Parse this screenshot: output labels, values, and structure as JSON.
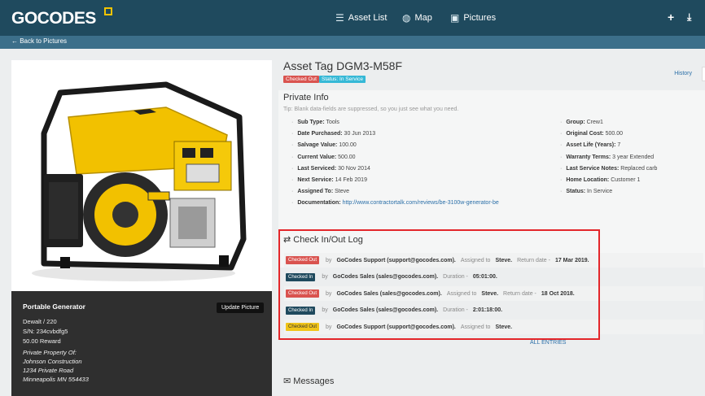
{
  "header": {
    "logo": "GOCODES",
    "nav": [
      {
        "label": "Asset List",
        "icon": "list-icon"
      },
      {
        "label": "Map",
        "icon": "globe-icon"
      },
      {
        "label": "Pictures",
        "icon": "pictures-icon"
      }
    ],
    "right_icons": [
      "plus-icon",
      "download-icon"
    ]
  },
  "subbar": {
    "back_label": "← Back to Pictures"
  },
  "left_panel": {
    "name": "Portable Generator",
    "update_button": "Update Picture",
    "model": "Dewalt / 220",
    "serial": "S/N: 234cvbdfg5",
    "reward": "50.00 Reward",
    "property_lines": [
      "Private Property Of:",
      "Johnson Construction",
      "1234 Private Road",
      "Minneapolis MN 554433"
    ]
  },
  "asset": {
    "title": "Asset Tag DGM3-M58F",
    "badges": [
      {
        "label": "Checked Out",
        "color": "#d9534f"
      },
      {
        "label": "Status: In Service",
        "color": "#35b8d6"
      }
    ],
    "history_label": "History"
  },
  "private_info": {
    "heading": "Private Info",
    "tip": "Tip: Blank data-fields are suppressed, so you just see what you need.",
    "left_fields": [
      {
        "label": "Sub Type:",
        "value": "Tools"
      },
      {
        "label": "Date Purchased:",
        "value": "30 Jun 2013"
      },
      {
        "label": "Salvage Value:",
        "value": "100.00"
      },
      {
        "label": "Current Value:",
        "value": "500.00"
      },
      {
        "label": "Last Serviced:",
        "value": "30 Nov 2014"
      },
      {
        "label": "Next Service:",
        "value": "14 Feb 2019"
      },
      {
        "label": "Assigned To:",
        "value": "Steve"
      },
      {
        "label": "Documentation:",
        "value": "http://www.contractortalk.com/reviews/be-3100w-generator-be"
      }
    ],
    "right_fields": [
      {
        "label": "Group:",
        "value": "Crew1"
      },
      {
        "label": "Original Cost:",
        "value": "500.00"
      },
      {
        "label": "Asset Life (Years):",
        "value": "7"
      },
      {
        "label": "Warranty Terms:",
        "value": "3 year Extended"
      },
      {
        "label": "Last Service Notes:",
        "value": "Replaced carb"
      },
      {
        "label": "Home Location:",
        "value": "Customer 1"
      },
      {
        "label": "Status:",
        "value": "In Service"
      }
    ]
  },
  "log": {
    "heading": "Check In/Out Log",
    "entries": [
      {
        "tag": "Checked Out",
        "tag_color": "#d9534f",
        "by": "by",
        "who": "GoCodes Support (support@gocodes.com).",
        "assigned_label": "Assigned to",
        "assignee": "Steve.",
        "extra_label": "Return date -",
        "extra_value": "17 Mar 2019."
      },
      {
        "tag": "Checked In",
        "tag_color": "#1f4a5e",
        "by": "by",
        "who": "GoCodes Sales (sales@gocodes.com).",
        "assigned_label": "",
        "assignee": "",
        "extra_label": "Duration -",
        "extra_value": "05:01:00."
      },
      {
        "tag": "Checked Out",
        "tag_color": "#d9534f",
        "by": "by",
        "who": "GoCodes Sales (sales@gocodes.com).",
        "assigned_label": "Assigned to",
        "assignee": "Steve.",
        "extra_label": "Return date -",
        "extra_value": "18 Oct 2018."
      },
      {
        "tag": "Checked In",
        "tag_color": "#1f4a5e",
        "by": "by",
        "who": "GoCodes Sales (sales@gocodes.com).",
        "assigned_label": "",
        "assignee": "",
        "extra_label": "Duration -",
        "extra_value": "2:01:18:00."
      },
      {
        "tag": "Checked Out",
        "tag_color": "#f0c419",
        "by": "by",
        "who": "GoCodes Support (support@gocodes.com).",
        "assigned_label": "Assigned to",
        "assignee": "Steve.",
        "extra_label": "",
        "extra_value": ""
      }
    ],
    "all_entries": "ALL ENTRIES"
  },
  "messages": {
    "heading": "Messages"
  }
}
